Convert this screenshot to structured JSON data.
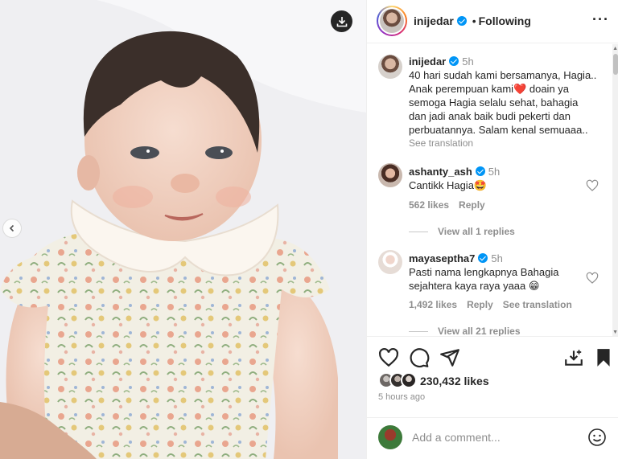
{
  "post": {
    "username": "inijedar",
    "following_label": "Following",
    "caption_time": "5h",
    "caption_lines": [
      "40 hari sudah kami bersamanya, Hagia..",
      "Anak perempuan kami❤️ doain ya",
      "semoga Hagia selalu sehat, bahagia",
      "dan jadi anak baik budi pekerti dan",
      "perbuatannya. Salam kenal semuaaa.."
    ],
    "see_translation": "See translation"
  },
  "comments": [
    {
      "username": "ashanty_ash",
      "time": "5h",
      "text": "Cantikk Hagia🤩",
      "likes": "562 likes",
      "reply": "Reply",
      "view_replies": "View all 1 replies"
    },
    {
      "username": "mayaseptha7",
      "time": "5h",
      "text_lines": [
        "Pasti nama lengkapnya Bahagia",
        "sejahtera kaya raya yaaa 😁"
      ],
      "likes": "1,492 likes",
      "reply": "Reply",
      "see_translation": "See translation",
      "view_replies": "View all 21 replies"
    }
  ],
  "footer": {
    "likes": "230,432 likes",
    "time_ago": "5 hours ago",
    "comment_placeholder": "Add a comment..."
  },
  "colors": {
    "verified": "#0095f6",
    "text": "#262626",
    "muted": "#8e8e8e"
  },
  "icons": [
    "download-icon",
    "chevron-left-icon",
    "more-icon",
    "heart-icon",
    "comment-icon",
    "share-icon",
    "save-icon",
    "emoji-icon"
  ]
}
